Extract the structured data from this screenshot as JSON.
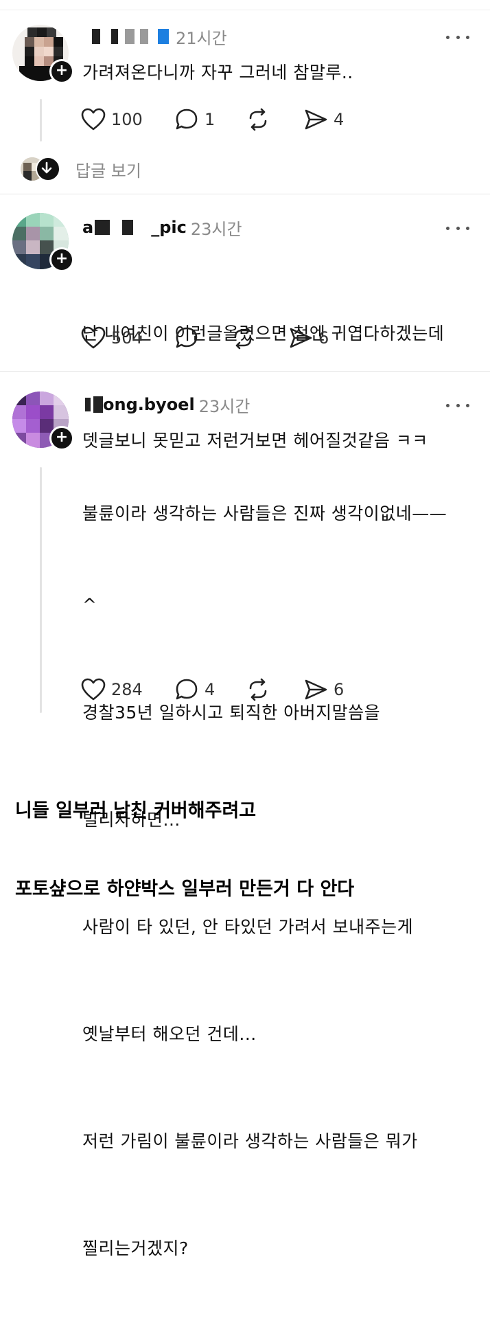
{
  "posts": [
    {
      "username_visible": "",
      "time": "21시간",
      "lines": [
        "가려져온다니까 자꾸 그러네 참말루.."
      ],
      "likes": "100",
      "comments": "1",
      "reposts": "",
      "shares": "4",
      "view_replies": "답글 보기"
    },
    {
      "username_prefix": "a",
      "username_suffix": "_pic",
      "time": "23시간",
      "lines": [
        "난 내여친이 이런글올렸으면 첨엔 귀엽다하겠는데",
        "뎃글보니 못믿고 저런거보면 헤어질것같음 ㅋㅋ"
      ],
      "likes": "504",
      "comments": "",
      "reposts": "",
      "shares": "6"
    },
    {
      "username_suffix": "ong.byoel",
      "time": "23시간",
      "lines": [
        "불륜이라 생각하는 사람들은 진짜 생각이없네——",
        "^",
        "경찰35년 일하시고 퇴직한 아버지말씀을",
        "빌리자하면...",
        "사람이 타 있던, 안 타있던 가려서 보내주는게",
        "옛날부터 해오던 건데...",
        "저런 가림이 불륜이라 생각하는 사람들은 뭐가",
        "찔리는거겠지?"
      ],
      "likes": "284",
      "comments": "4",
      "reposts": "",
      "shares": "6"
    }
  ],
  "caption": [
    "니들 일부러 남친 커버해주려고",
    "포토샾으로 하얀박스 일부러 만든거 다 안다"
  ],
  "icons": [
    "heart-icon",
    "comment-icon",
    "repost-icon",
    "share-icon",
    "more-icon",
    "follow-plus-icon",
    "reply-arrow-icon"
  ],
  "colors": {
    "text": "#111111",
    "muted": "#8a8a8a",
    "mask_blue": "#1d7fe0"
  }
}
